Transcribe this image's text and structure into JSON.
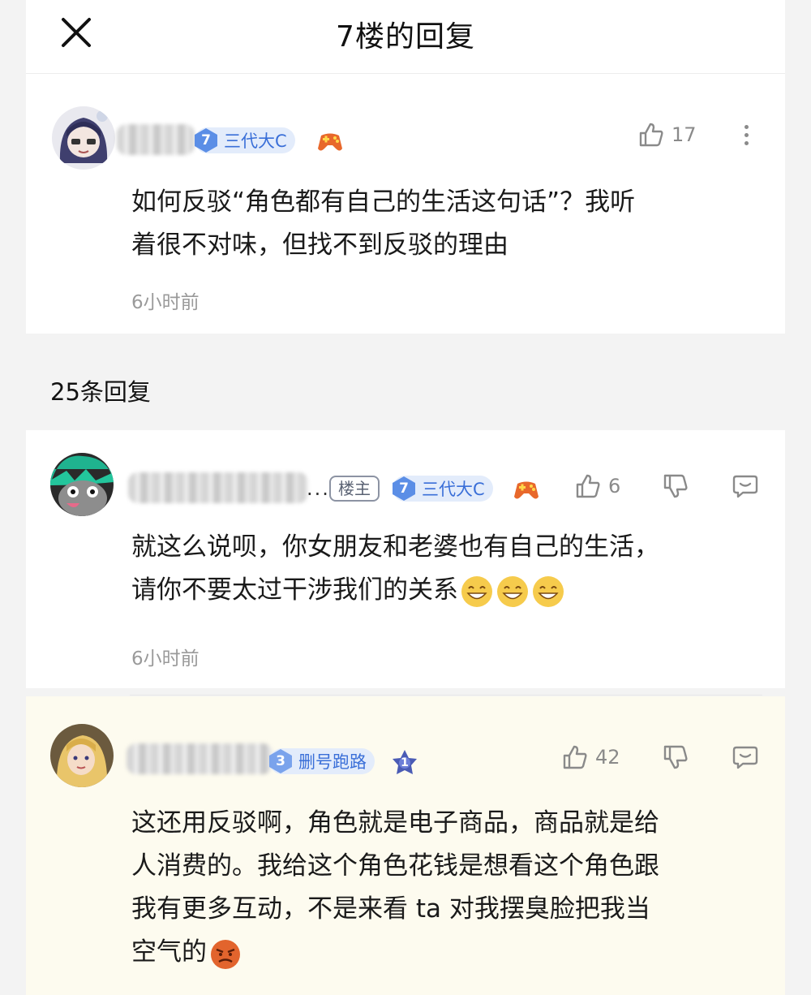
{
  "header": {
    "title": "7楼的回复",
    "close_icon": "close-icon"
  },
  "op": {
    "level": "7",
    "level_title": "三代大C",
    "like_count": "17",
    "text": "如何反驳“角色都有自己的生活这句话”？我听\n着很不对味，但找不到反驳的理由",
    "time": "6小时前"
  },
  "reply_count": "25条回复",
  "replies": [
    {
      "name_suffix": "...",
      "host_tag": "楼主",
      "level": "7",
      "level_title": "三代大C",
      "like_count": "6",
      "text": "就这么说呗，你女朋友和老婆也有自己的生活，\n请你不要太过干涉我们的关系",
      "emoji_count": 3,
      "time": "6小时前"
    },
    {
      "level": "3",
      "level_title": "删号跑路",
      "rank_badge": "1",
      "like_count": "42",
      "text": "这还用反驳啊，角色就是电子商品，商品就是给\n人消费的。我给这个角色花钱是想看这个角色跟\n我有更多互动，不是来看 ta 对我摆臭脸把我当\n空气的"
    }
  ],
  "colors": {
    "level_badge_bg": "#e3ecfb",
    "level_text": "#3a6fd8",
    "highlight_bg": "#fdfbef"
  }
}
